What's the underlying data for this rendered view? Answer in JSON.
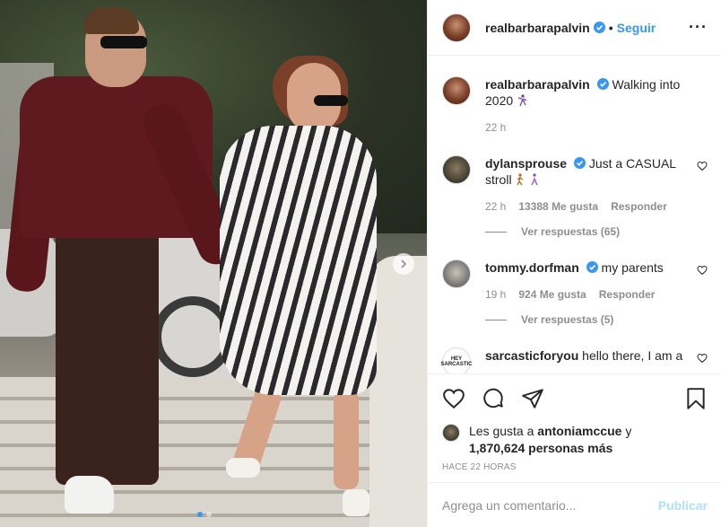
{
  "header": {
    "username": "realbarbarapalvin",
    "bullet": "•",
    "follow_label": "Seguir",
    "more_label": "···"
  },
  "caption": {
    "username": "realbarbarapalvin",
    "text": "Walking into 2020",
    "emoji": "dancing-woman-emoji",
    "time": "22 h"
  },
  "comments": [
    {
      "username": "dylansprouse",
      "text": "Just a CASUAL stroll",
      "emojis": [
        "walking-person-emoji",
        "walking-woman-emoji"
      ],
      "time": "22 h",
      "likes": "13388 Me gusta",
      "reply_label": "Responder",
      "view_replies": "Ver respuestas (65)"
    },
    {
      "username": "tommy.dorfman",
      "text": "my parents",
      "time": "19 h",
      "likes": "924 Me gusta",
      "reply_label": "Responder",
      "view_replies": "Ver respuestas (5)"
    },
    {
      "username": "sarcasticforyou",
      "text": "hello there, I am a",
      "avatar_text": "HEY SARCASTIC"
    }
  ],
  "actions": {
    "likes_prefix": "Les gusta a",
    "likes_user": "antoniamccue",
    "likes_conj": "y",
    "likes_others": "1,870,624 personas más",
    "timestamp": "HACE 22 HORAS"
  },
  "composer": {
    "placeholder": "Agrega un comentario...",
    "publish_label": "Publicar"
  },
  "carousel": {
    "total_slides": 2,
    "active_slide": 1
  },
  "colors": {
    "accent": "#3897f0",
    "publish_disabled": "#b2dffc",
    "muted": "#8e8e8e",
    "text": "#262626"
  }
}
